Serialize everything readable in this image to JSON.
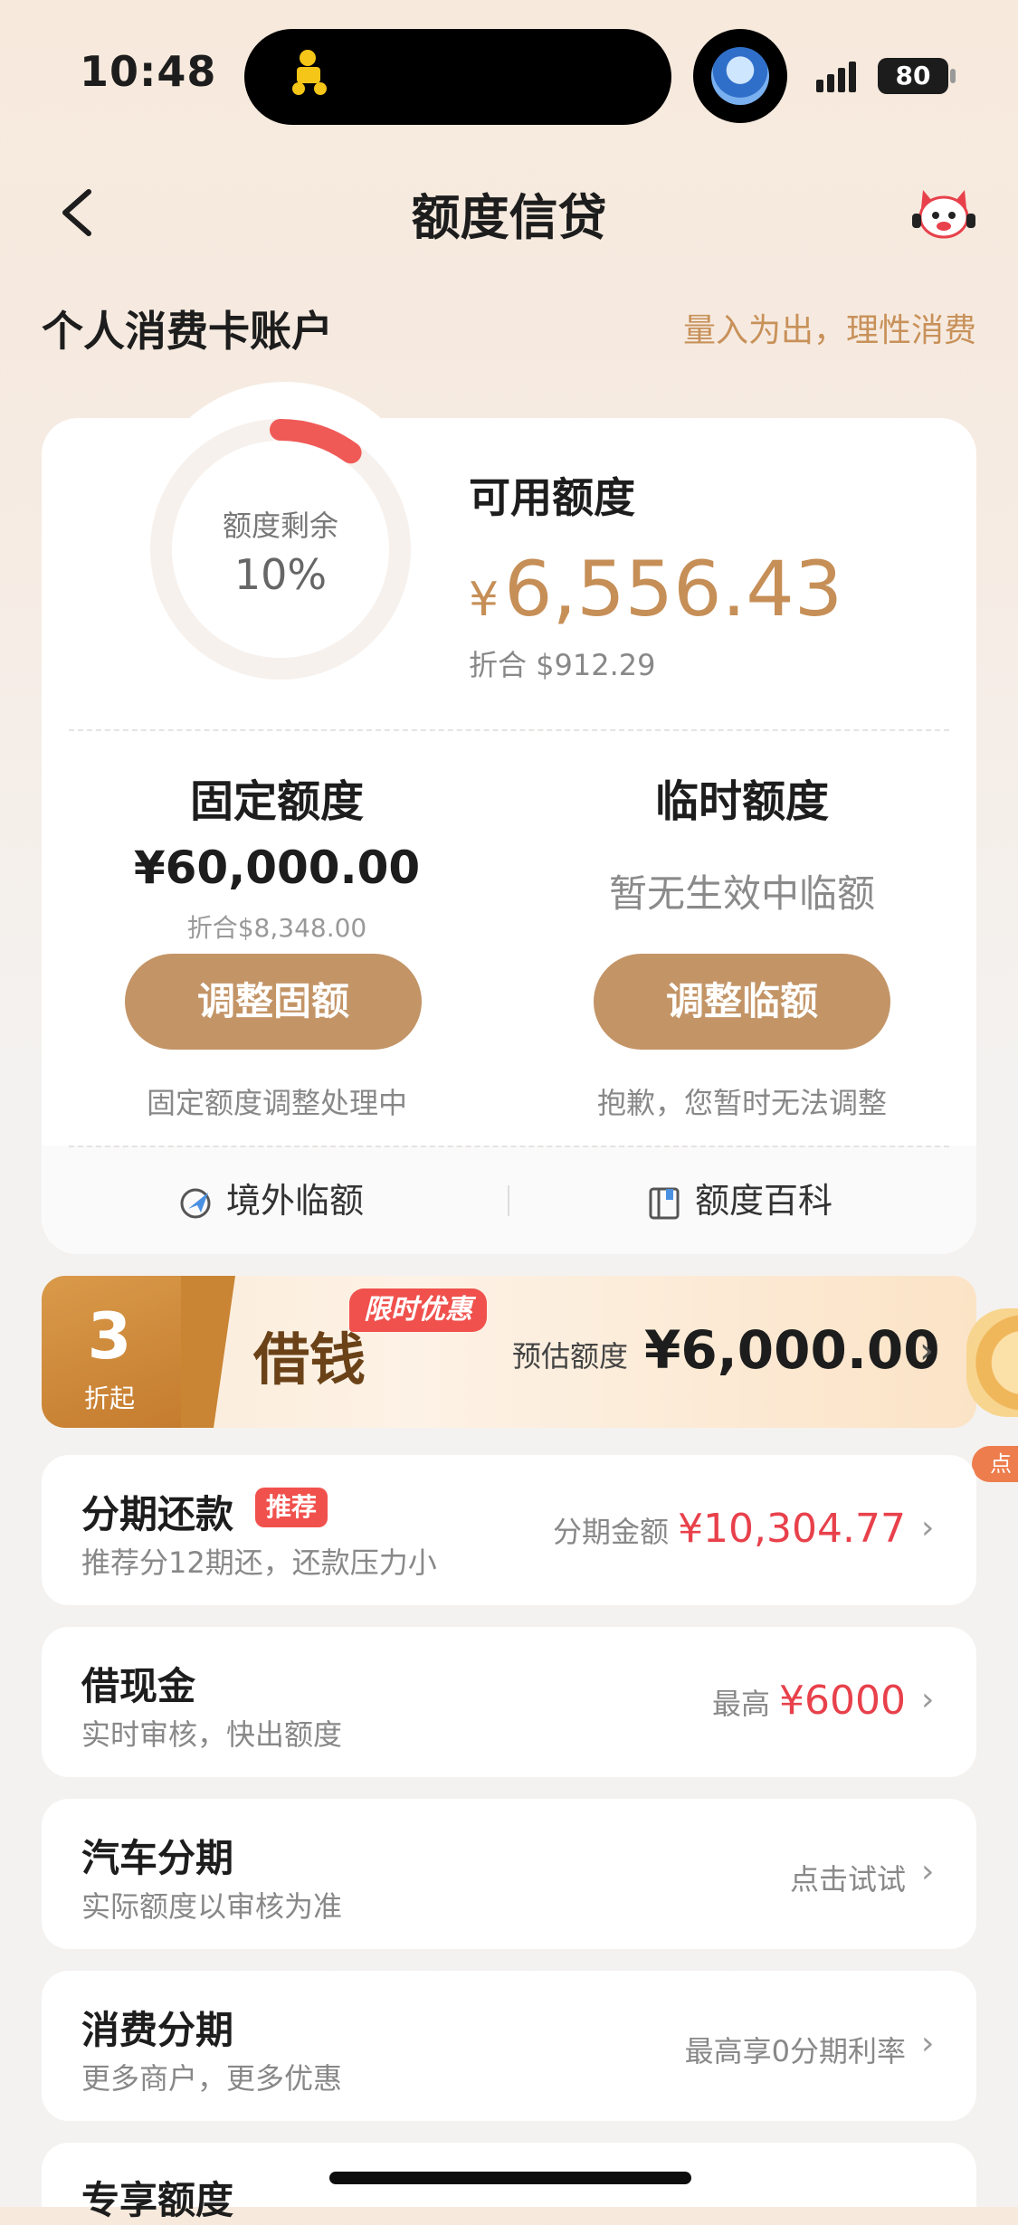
{
  "status_bar": {
    "time": "10:48",
    "battery": "80"
  },
  "nav": {
    "title": "额度信贷"
  },
  "account": {
    "title": "个人消费卡账户",
    "slogan": "量入为出，理性消费"
  },
  "credit": {
    "ring_label": "额度剩余",
    "ring_percent_text": "10%",
    "remaining_fraction": 0.1,
    "available_label": "可用额度",
    "available_currency": "¥",
    "available_amount": "6,556.43",
    "available_converted": "折合 $912.29",
    "fixed": {
      "title": "固定额度",
      "amount": "¥60,000.00",
      "converted": "折合$8,348.00",
      "button": "调整固额",
      "note": "固定额度调整处理中"
    },
    "temporary": {
      "title": "临时额度",
      "empty_text": "暂无生效中临额",
      "button": "调整临额",
      "note": "抱歉，您暂时无法调整"
    },
    "tools": [
      {
        "label": "境外临额",
        "icon": "globe-plane-icon"
      },
      {
        "label": "额度百科",
        "icon": "book-icon"
      }
    ]
  },
  "promo": {
    "number": "3",
    "number_sub": "折起",
    "title": "借钱",
    "tag": "限时优惠",
    "estimate_label": "预估额度",
    "estimate_amount": "¥6,000.00",
    "side_coin_tag": "点"
  },
  "items": [
    {
      "title": "分期还款",
      "tag": "推荐",
      "subtitle": "推荐分12期还，还款压力小",
      "right_label": "分期金额",
      "right_value": "¥10,304.77"
    },
    {
      "title": "借现金",
      "subtitle": "实时审核，快出额度",
      "right_label": "最高",
      "right_value": "¥6000"
    },
    {
      "title": "汽车分期",
      "subtitle": "实际额度以审核为准",
      "right_label": "点击试试"
    },
    {
      "title": "消费分期",
      "subtitle": "更多商户，更多优惠",
      "right_label": "最高享0分期利率"
    },
    {
      "title": "专享额度"
    }
  ],
  "colors": {
    "accent": "#c39466",
    "amount": "#c68f57",
    "red": "#e8414b",
    "ring": "#ef5a57"
  }
}
